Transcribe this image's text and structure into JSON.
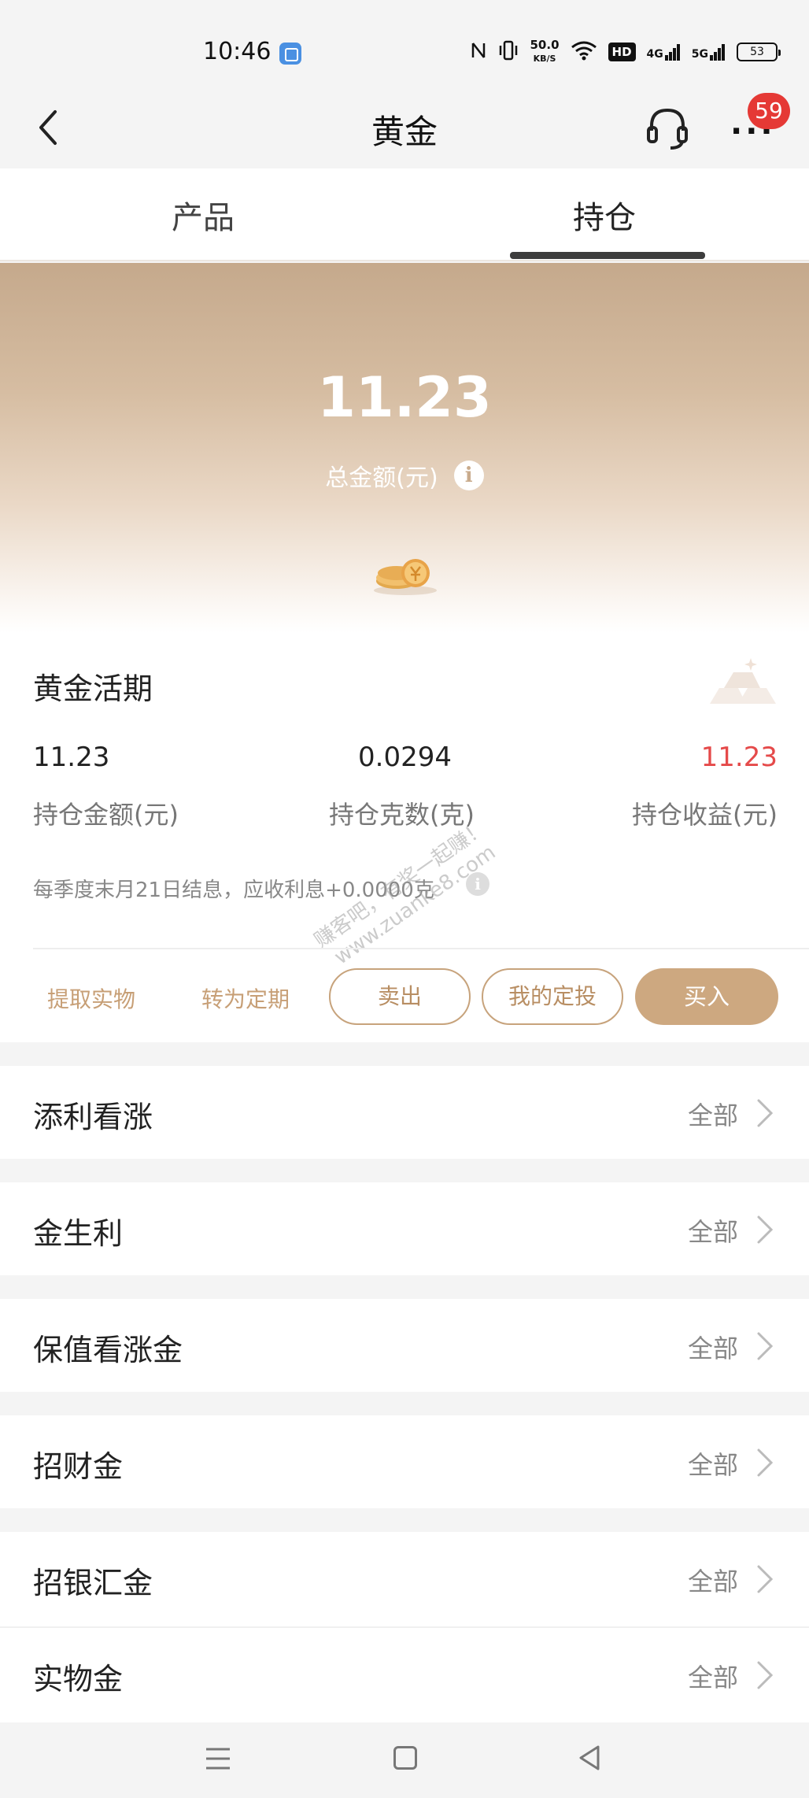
{
  "status_bar": {
    "time": "10:46",
    "speed_value": "50.0",
    "speed_unit": "KB/S",
    "hd_label": "HD",
    "net1": "4G",
    "net2": "5G",
    "battery": "53"
  },
  "header": {
    "title": "黄金",
    "badge_count": "59"
  },
  "tabs": [
    {
      "label": "产品",
      "active": false
    },
    {
      "label": "持仓",
      "active": true
    }
  ],
  "summary": {
    "total_amount": "11.23",
    "total_label": "总金额(元)"
  },
  "holding_card": {
    "title": "黄金活期",
    "stats": [
      {
        "value": "11.23",
        "label": "持仓金额(元)"
      },
      {
        "value": "0.0294",
        "label": "持仓克数(克)"
      },
      {
        "value": "11.23",
        "label": "持仓收益(元)"
      }
    ],
    "interest_note": "每季度末月21日结息，应收利息+0.0000克",
    "watermark": "赚客吧，有奖一起赚！ www.zuanke8.com",
    "actions": {
      "withdraw": "提取实物",
      "to_fixed": "转为定期",
      "sell": "卖出",
      "my_plan": "我的定投",
      "buy": "买入"
    }
  },
  "products": [
    {
      "name": "添利看涨",
      "link": "全部"
    },
    {
      "name": "金生利",
      "link": "全部"
    },
    {
      "name": "保值看涨金",
      "link": "全部"
    },
    {
      "name": "招财金",
      "link": "全部"
    },
    {
      "name": "招银汇金",
      "link": "全部"
    },
    {
      "name": "实物金",
      "link": "全部"
    }
  ],
  "colors": {
    "accent": "#cda880",
    "profit": "#e54a4a",
    "badge": "#e53935"
  }
}
